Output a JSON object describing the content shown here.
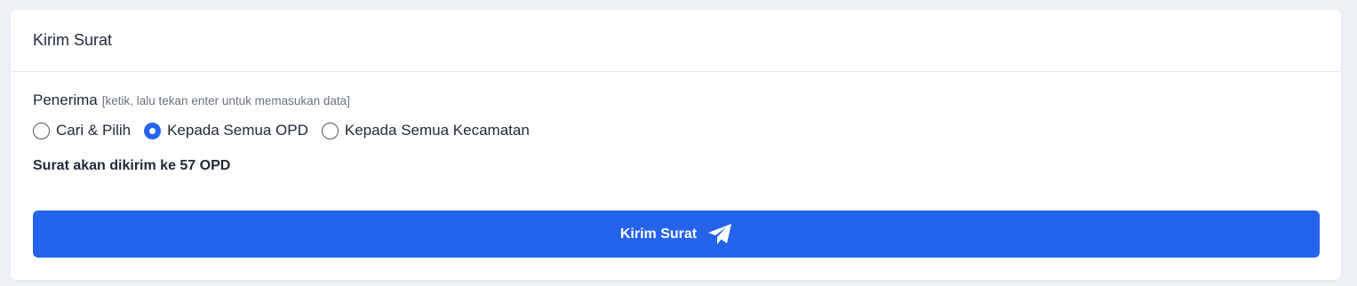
{
  "card": {
    "title": "Kirim Surat"
  },
  "recipient": {
    "label": "Penerima",
    "hint": "[ketik, lalu tekan enter untuk memasukan data]",
    "options": [
      {
        "label": "Cari & Pilih",
        "checked": false
      },
      {
        "label": "Kepada Semua OPD",
        "checked": true
      },
      {
        "label": "Kepada Semua Kecamatan",
        "checked": false
      }
    ]
  },
  "summary": "Surat akan dikirim ke 57 OPD",
  "submit": {
    "label": "Kirim Surat",
    "icon": "paper-plane-icon"
  },
  "colors": {
    "primary": "#2563eb",
    "background": "#eef1f6",
    "card": "#ffffff"
  }
}
